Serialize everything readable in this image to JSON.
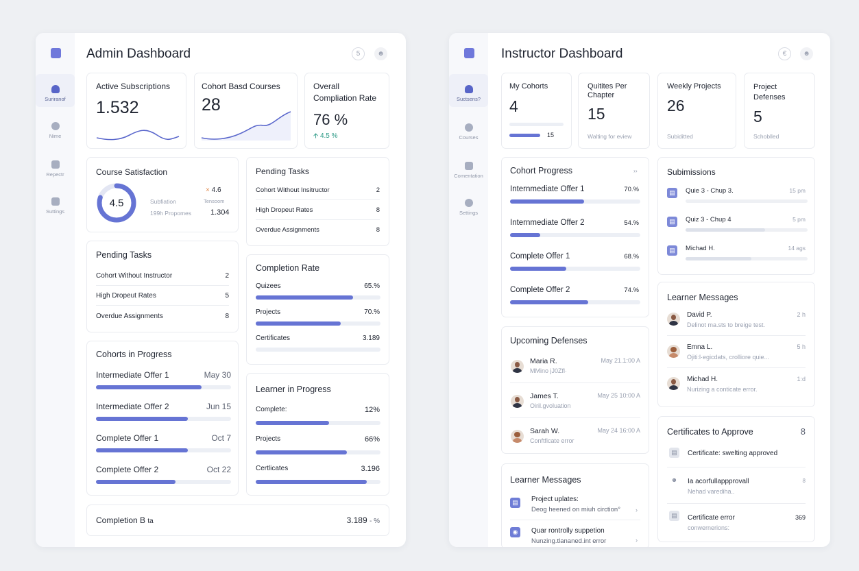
{
  "admin": {
    "title": "Admin Dashboard",
    "sidebar": [
      {
        "label": "Suriranof",
        "icon": "subscriptions-icon",
        "active": true
      },
      {
        "label": "Nime",
        "icon": "circle-icon"
      },
      {
        "label": "Repectr",
        "icon": "reports-icon"
      },
      {
        "label": "Suttings",
        "icon": "settings-icon"
      }
    ],
    "header_icons": {
      "help": "5",
      "user": "user-icon"
    },
    "stats": [
      {
        "title": "Active Subscriptions",
        "value": "1.532"
      },
      {
        "title": "Cohort Basd Courses",
        "value": "28"
      },
      {
        "title": "Overall Compliation Rate",
        "value": "76 %",
        "delta": "4.5 %"
      }
    ],
    "satisfaction": {
      "title": "Course Satisfaction",
      "score": "4.5",
      "score_fraction": 0.8,
      "rating": "4.6",
      "rating_prefix": "×",
      "sub_label": "Subfiation",
      "responses": "199h Propomes",
      "side_label": "Tensoom",
      "side_value": "1.304"
    },
    "pending_left": {
      "title": "Pending Tasks",
      "rows": [
        {
          "label": "Cohort Without Instructor",
          "value": "2"
        },
        {
          "label": "High Dropeut Rates",
          "value": "5"
        },
        {
          "label": "Overdue Assignments",
          "value": "8"
        }
      ]
    },
    "pending_right": {
      "title": "Pending Tasks",
      "rows": [
        {
          "label": "Cohort Without Insitructor",
          "value": "2"
        },
        {
          "label": "High Dropeut Rates",
          "value": "8"
        },
        {
          "label": "Overdue Assignments",
          "value": "8"
        }
      ]
    },
    "cohorts": {
      "title": "Cohorts in Progress",
      "items": [
        {
          "label": "Intermediate Offer 1",
          "date": "May 30",
          "progress": 0.78
        },
        {
          "label": "Intermediate Offer 2",
          "date": "Jun 15",
          "progress": 0.68
        },
        {
          "label": "Complete Offer 1",
          "date": "Oct 7",
          "progress": 0.68
        },
        {
          "label": "Complete Offer 2",
          "date": "Oct 22",
          "progress": 0.59
        }
      ]
    },
    "completion": {
      "title": "Completion Rate",
      "items": [
        {
          "label": "Quizees",
          "value": "65.%",
          "progress": 0.78
        },
        {
          "label": "Projects",
          "value": "70.%",
          "progress": 0.68
        },
        {
          "label": "Certificates",
          "value": "3.189",
          "progress": 0
        }
      ]
    },
    "learner": {
      "title": "Learner in Progress",
      "items": [
        {
          "label": "Complete:",
          "value": "12%",
          "progress": 0.59
        },
        {
          "label": "Projects",
          "value": "66%",
          "progress": 0.73
        },
        {
          "label": "Certlicates",
          "value": "3.196",
          "progress": 0.89
        }
      ]
    },
    "completion_b": {
      "label": "Completion B",
      "label_suffix": "ta",
      "value": "3.189",
      "value_suffix": "- %"
    }
  },
  "instructor": {
    "title": "Instructor Dashboard",
    "sidebar": [
      {
        "label": "Suctsens?",
        "icon": "subscriptions-icon",
        "active": true
      },
      {
        "label": "Courses",
        "icon": "courses-icon"
      },
      {
        "label": "Comentation",
        "icon": "mail-icon"
      },
      {
        "label": "Settings",
        "icon": "settings-icon"
      }
    ],
    "header_icons": {
      "help": "€",
      "user": "user-icon"
    },
    "stats": [
      {
        "title": "My Cohorts",
        "value": "4",
        "bar_value": "15",
        "progress": 0.57
      },
      {
        "title": "Quitites Per Chapter",
        "value": "15",
        "sub": "Walting for eview"
      },
      {
        "title": "Weekly Projects",
        "value": "26",
        "sub": "Subiditted"
      },
      {
        "title": "Project Defenses",
        "value": "5",
        "sub": "Schoblled"
      }
    ],
    "cohort_progress": {
      "title": "Cohort Progress",
      "more": "››",
      "items": [
        {
          "label": "Internmediate Offer 1",
          "value": "70.%",
          "progress": 0.57
        },
        {
          "label": "Internmediate Offer 2",
          "value": "54.%",
          "progress": 0.23
        },
        {
          "label": "Complete Offer 1",
          "value": "68.%",
          "progress": 0.43
        },
        {
          "label": "Complete Offer 2",
          "value": "74.%",
          "progress": 0.6
        }
      ]
    },
    "submissions": {
      "title": "Subimissions",
      "items": [
        {
          "label": "Quie 3 - Chup 3.",
          "time": "15 pm",
          "progress": 0
        },
        {
          "label": "Quiz 3 - Chup 4",
          "time": "5 pm",
          "progress": 0.65
        },
        {
          "label": "Michad H.",
          "time": "14 ags",
          "progress": 0.54
        }
      ]
    },
    "defenses": {
      "title": "Upcoming Defenses",
      "items": [
        {
          "name": "Maria R.",
          "sub": "MMino jJ0Zfl·",
          "time": "May 21.1:00 A"
        },
        {
          "name": "James T.",
          "sub": "Oiril.gvoluation",
          "time": "May 25 10:00 A"
        },
        {
          "name": "Sarah W.",
          "sub": "Conftficate error",
          "time": "May 24 16:00 A"
        }
      ]
    },
    "messages_right": {
      "title": "Learner Messages",
      "items": [
        {
          "name": "David P.",
          "sub": "Delinot ma.sts to breige test.",
          "time": "2 h"
        },
        {
          "name": "Emna L.",
          "sub": "Ojiti:l·egicdats, crolliore quie...",
          "time": "5 h"
        },
        {
          "name": "Michad H.",
          "sub": "Nurizing a conticate error.",
          "time": "1:d"
        }
      ]
    },
    "messages_left": {
      "title": "Learner Messages",
      "items": [
        {
          "name": "Project uplates:",
          "sub": "Deog heened on miuh cirction°",
          "chev": "›"
        },
        {
          "name": "Quar rontrolly suppetion",
          "sub": "Nunzing.tlananed.int error",
          "chev": "›"
        }
      ]
    },
    "certificates": {
      "title": "Certificates to Approve",
      "count": "8",
      "items": [
        {
          "name": "Certificate: swelting approved",
          "sub": "",
          "value": ""
        },
        {
          "name": "Ia acorfullappprovall",
          "sub": "Nehad varediha..",
          "value": "8"
        },
        {
          "name": "Certificate error",
          "sub": "conwernerions:",
          "value": "369"
        }
      ]
    }
  }
}
